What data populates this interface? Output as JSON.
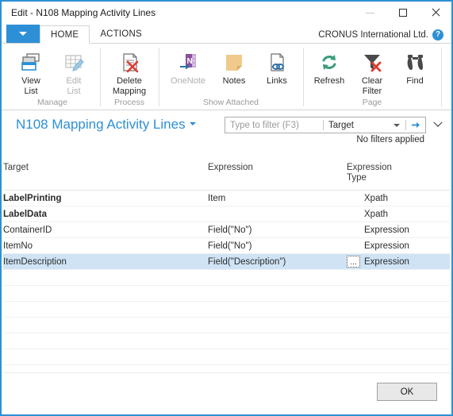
{
  "window": {
    "title": "Edit - N108 Mapping Activity Lines",
    "controls": {
      "minimize": "minimize-icon",
      "maximize": "maximize-icon",
      "close": "close-icon"
    }
  },
  "ribbon": {
    "dropdown_icon": "chevron-down-icon",
    "tabs": [
      {
        "label": "HOME",
        "active": true
      },
      {
        "label": "ACTIONS",
        "active": false
      }
    ],
    "company": "CRONUS International Ltd.",
    "help_icon": "help-icon",
    "groups": [
      {
        "label": "Manage",
        "buttons": [
          {
            "label_line1": "View",
            "label_line2": "List",
            "icon": "view-list-icon",
            "disabled": false
          },
          {
            "label_line1": "Edit",
            "label_line2": "List",
            "icon": "edit-list-icon",
            "disabled": true
          }
        ]
      },
      {
        "label": "Process",
        "buttons": [
          {
            "label_line1": "Delete",
            "label_line2": "Mapping",
            "icon": "delete-mapping-icon",
            "disabled": false
          }
        ]
      },
      {
        "label": "Show Attached",
        "buttons": [
          {
            "label_line1": "OneNote",
            "label_line2": "",
            "icon": "onenote-icon",
            "disabled": true
          },
          {
            "label_line1": "Notes",
            "label_line2": "",
            "icon": "notes-icon",
            "disabled": false
          },
          {
            "label_line1": "Links",
            "label_line2": "",
            "icon": "links-icon",
            "disabled": false
          }
        ]
      },
      {
        "label": "Page",
        "buttons": [
          {
            "label_line1": "Refresh",
            "label_line2": "",
            "icon": "refresh-icon",
            "disabled": false
          },
          {
            "label_line1": "Clear",
            "label_line2": "Filter",
            "icon": "clear-filter-icon",
            "disabled": false
          },
          {
            "label_line1": "Find",
            "label_line2": "",
            "icon": "find-icon",
            "disabled": false
          }
        ]
      }
    ]
  },
  "page": {
    "title": "N108 Mapping Activity Lines",
    "filter": {
      "placeholder": "Type to filter (F3)",
      "field": "Target",
      "field_caret_icon": "chevron-down-icon",
      "go_icon": "arrow-right-icon",
      "expand_icon": "chevron-down-icon",
      "status": "No filters applied"
    }
  },
  "grid": {
    "columns": [
      {
        "label": "Target"
      },
      {
        "label": "Expression"
      },
      {
        "label_line1": "Expression",
        "label_line2": "Type"
      }
    ],
    "rows": [
      {
        "target": "LabelPrinting",
        "expression": "Item",
        "type": "Xpath",
        "indent": 0,
        "bold": true,
        "selected": false,
        "assist": false
      },
      {
        "target": "LabelData",
        "expression": "",
        "type": "Xpath",
        "indent": 1,
        "bold": true,
        "selected": false,
        "assist": false
      },
      {
        "target": "ContainerID",
        "expression": "Field(\"No\")",
        "type": "Expression",
        "indent": 2,
        "bold": false,
        "selected": false,
        "assist": false
      },
      {
        "target": "ItemNo",
        "expression": "Field(\"No\")",
        "type": "Expression",
        "indent": 2,
        "bold": false,
        "selected": false,
        "assist": false
      },
      {
        "target": "ItemDescription",
        "expression": "Field(\"Description\")",
        "type": "Expression",
        "indent": 2,
        "bold": false,
        "selected": true,
        "assist": true
      }
    ],
    "assist_button_label": "...",
    "empty_row_count": 7
  },
  "footer": {
    "ok_label": "OK"
  },
  "colors": {
    "accent": "#2d8fd5",
    "selection": "#cfe3f5",
    "title_link": "#2d8fd5",
    "disabled_text": "#b0b0b0"
  }
}
